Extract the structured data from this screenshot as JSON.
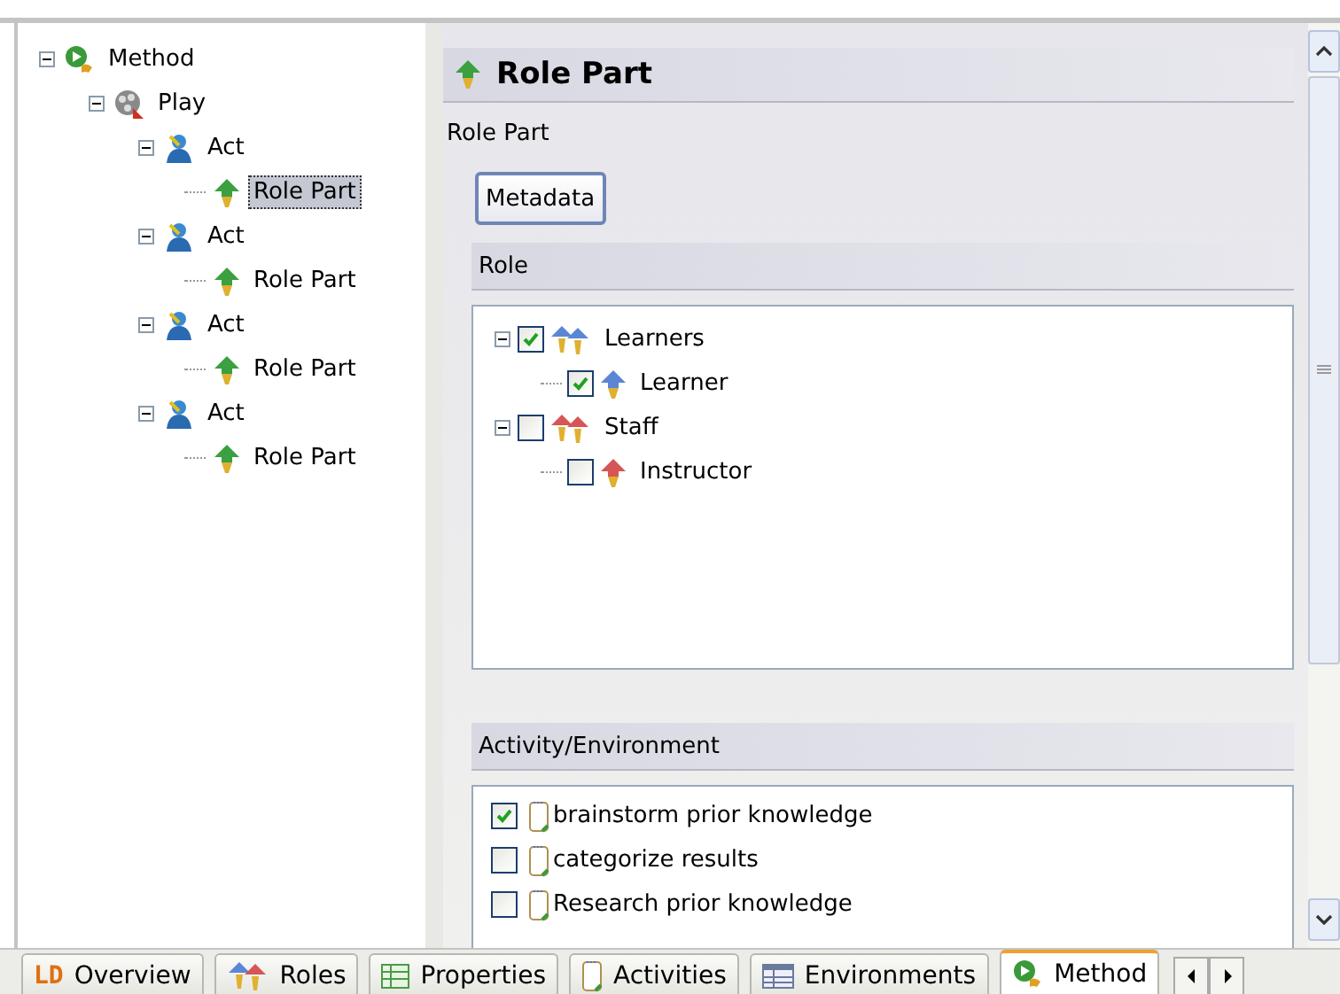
{
  "outline": {
    "items": [
      {
        "label": "Method",
        "kind": "method",
        "expanded": true,
        "selected": false,
        "children": [
          {
            "label": "Play",
            "kind": "play",
            "expanded": true,
            "selected": false,
            "children": [
              {
                "label": "Act",
                "kind": "act",
                "expanded": true,
                "selected": false,
                "children": [
                  {
                    "label": "Role Part",
                    "kind": "rolepart",
                    "selected": true
                  }
                ]
              },
              {
                "label": "Act",
                "kind": "act",
                "expanded": true,
                "selected": false,
                "children": [
                  {
                    "label": "Role Part",
                    "kind": "rolepart",
                    "selected": false
                  }
                ]
              },
              {
                "label": "Act",
                "kind": "act",
                "expanded": true,
                "selected": false,
                "children": [
                  {
                    "label": "Role Part",
                    "kind": "rolepart",
                    "selected": false
                  }
                ]
              },
              {
                "label": "Act",
                "kind": "act",
                "expanded": true,
                "selected": false,
                "children": [
                  {
                    "label": "Role Part",
                    "kind": "rolepart",
                    "selected": false
                  }
                ]
              }
            ]
          }
        ]
      }
    ]
  },
  "editor": {
    "title": "Role Part",
    "label": "Role Part",
    "metadata_button": "Metadata",
    "role_section": {
      "title": "Role",
      "items": [
        {
          "label": "Learners",
          "group": true,
          "color": "#5b86d6",
          "checked": true,
          "expanded": true,
          "children": [
            {
              "label": "Learner",
              "group": false,
              "color": "#5b86d6",
              "checked": true
            }
          ]
        },
        {
          "label": "Staff",
          "group": true,
          "color": "#d65656",
          "checked": false,
          "expanded": true,
          "children": [
            {
              "label": "Instructor",
              "group": false,
              "color": "#d65656",
              "checked": false
            }
          ]
        }
      ]
    },
    "activity_section": {
      "title": "Activity/Environment",
      "items": [
        {
          "label": "brainstorm prior knowledge",
          "checked": true
        },
        {
          "label": "categorize results",
          "checked": false
        },
        {
          "label": "Research prior knowledge",
          "checked": false
        }
      ]
    }
  },
  "tabs": [
    {
      "label": "Overview",
      "kind": "ld",
      "logo_text": "LD",
      "selected": false
    },
    {
      "label": "Roles",
      "kind": "roles",
      "selected": false
    },
    {
      "label": "Properties",
      "kind": "properties",
      "selected": false
    },
    {
      "label": "Activities",
      "kind": "activities",
      "selected": false
    },
    {
      "label": "Environments",
      "kind": "environments",
      "selected": false
    },
    {
      "label": "Method",
      "kind": "method",
      "selected": true
    }
  ]
}
